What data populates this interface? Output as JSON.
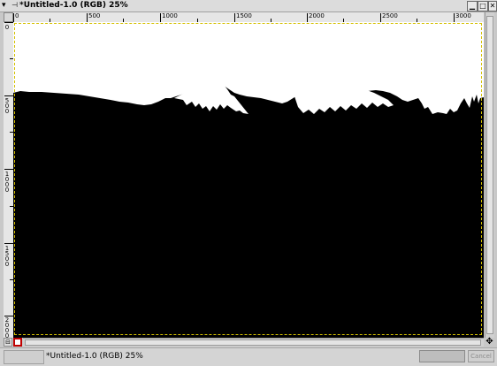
{
  "window": {
    "title": "*Untitled-1.0 (RGB) 25%",
    "menu_icon": "menu-arrow-icon",
    "pin_icon": "pin-icon",
    "buttons": [
      "minimize-icon",
      "maximize-icon",
      "close-icon"
    ]
  },
  "rulers": {
    "horizontal_labels": [
      "0",
      "500",
      "1000",
      "1500",
      "2000",
      "2500",
      "3000"
    ],
    "vertical_labels": [
      "0",
      "500",
      "1000",
      "1500",
      "2000"
    ]
  },
  "canvas": {
    "sky_color": "#ffffff",
    "ground_color": "#000000",
    "selection_color": "#d4c000"
  },
  "statusbar": {
    "text": "*Untitled-1.0 (RGB) 25%",
    "cancel_label": "Cancel"
  },
  "colors": {
    "mode_indicator": "#c00000"
  }
}
